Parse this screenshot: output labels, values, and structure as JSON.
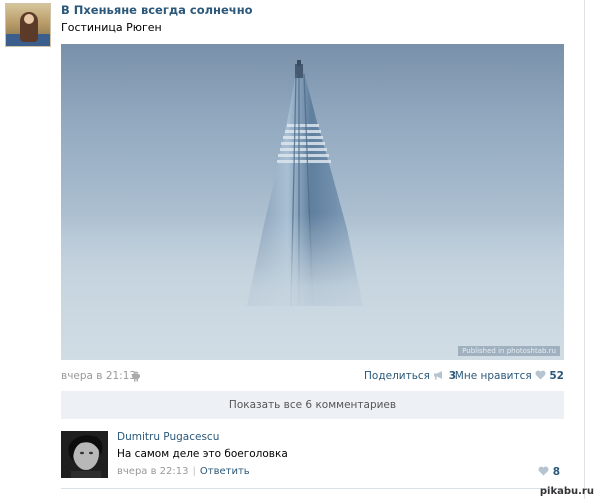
{
  "post": {
    "group_name": "В Пхеньяне всегда солнечно",
    "text": "Гостиница Рюген",
    "photo_watermark": "Published in photoshtab.ru",
    "time": "вчера в 21:13",
    "share_label": "Поделиться",
    "share_count": "3",
    "like_label": "Мне нравится",
    "like_count": "52"
  },
  "comments": {
    "show_all_label": "Показать все 6 комментариев",
    "items": [
      {
        "author": "Dumitru Pugacescu",
        "text": "На самом деле это боеголовка",
        "time": "вчера в 22:13",
        "reply_label": "Ответить",
        "like_count": "8"
      }
    ]
  },
  "site_watermark": "pikabu.ru",
  "colors": {
    "link": "#2b587a",
    "meta": "#999999",
    "panel": "#edf1f5"
  },
  "icons": [
    "android-icon",
    "megaphone-icon",
    "heart-icon"
  ]
}
